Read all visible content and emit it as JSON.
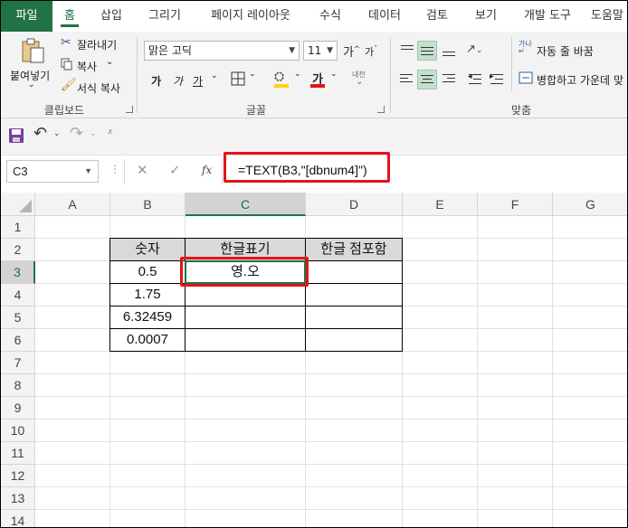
{
  "ribbon_tabs": [
    "파일",
    "홈",
    "삽입",
    "그리기",
    "페이지 레이아웃",
    "수식",
    "데이터",
    "검토",
    "보기",
    "개발 도구",
    "도움말"
  ],
  "clipboard": {
    "paste_label": "붙여넣기",
    "cut_label": "잘라내기",
    "copy_label": "복사",
    "format_painter_label": "서식 복사",
    "group_label": "클립보드"
  },
  "font": {
    "font_name": "맑은 고딕",
    "font_size": "11",
    "grow_label": "가",
    "shrink_label": "가",
    "bold_label": "가",
    "italic_label": "가",
    "underline_label": "가",
    "font_color_label": "가",
    "phonetic_label": "내천",
    "group_label": "글꼴"
  },
  "alignment": {
    "wrap_text_label": "자동 줄 바꿈",
    "merge_center_label": "병합하고 가운데 맞",
    "group_label": "맞춤"
  },
  "name_box": "C3",
  "formula": "=TEXT(B3,\"[dbnum4]\")",
  "fx_label": "fx",
  "columns": [
    "A",
    "B",
    "C",
    "D",
    "E",
    "F",
    "G"
  ],
  "rows": [
    "1",
    "2",
    "3",
    "4",
    "5",
    "6",
    "7",
    "8",
    "9",
    "10",
    "11",
    "12",
    "13",
    "14"
  ],
  "table": {
    "headers": [
      "숫자",
      "한글표기",
      "한글 점포함"
    ],
    "rows": [
      [
        "0.5",
        "영.오",
        ""
      ],
      [
        "1.75",
        "",
        ""
      ],
      [
        "6.32459",
        "",
        ""
      ],
      [
        "0.0007",
        "",
        ""
      ]
    ]
  },
  "colors": {
    "accent": "#217346",
    "highlight_box": "#e5141b"
  }
}
